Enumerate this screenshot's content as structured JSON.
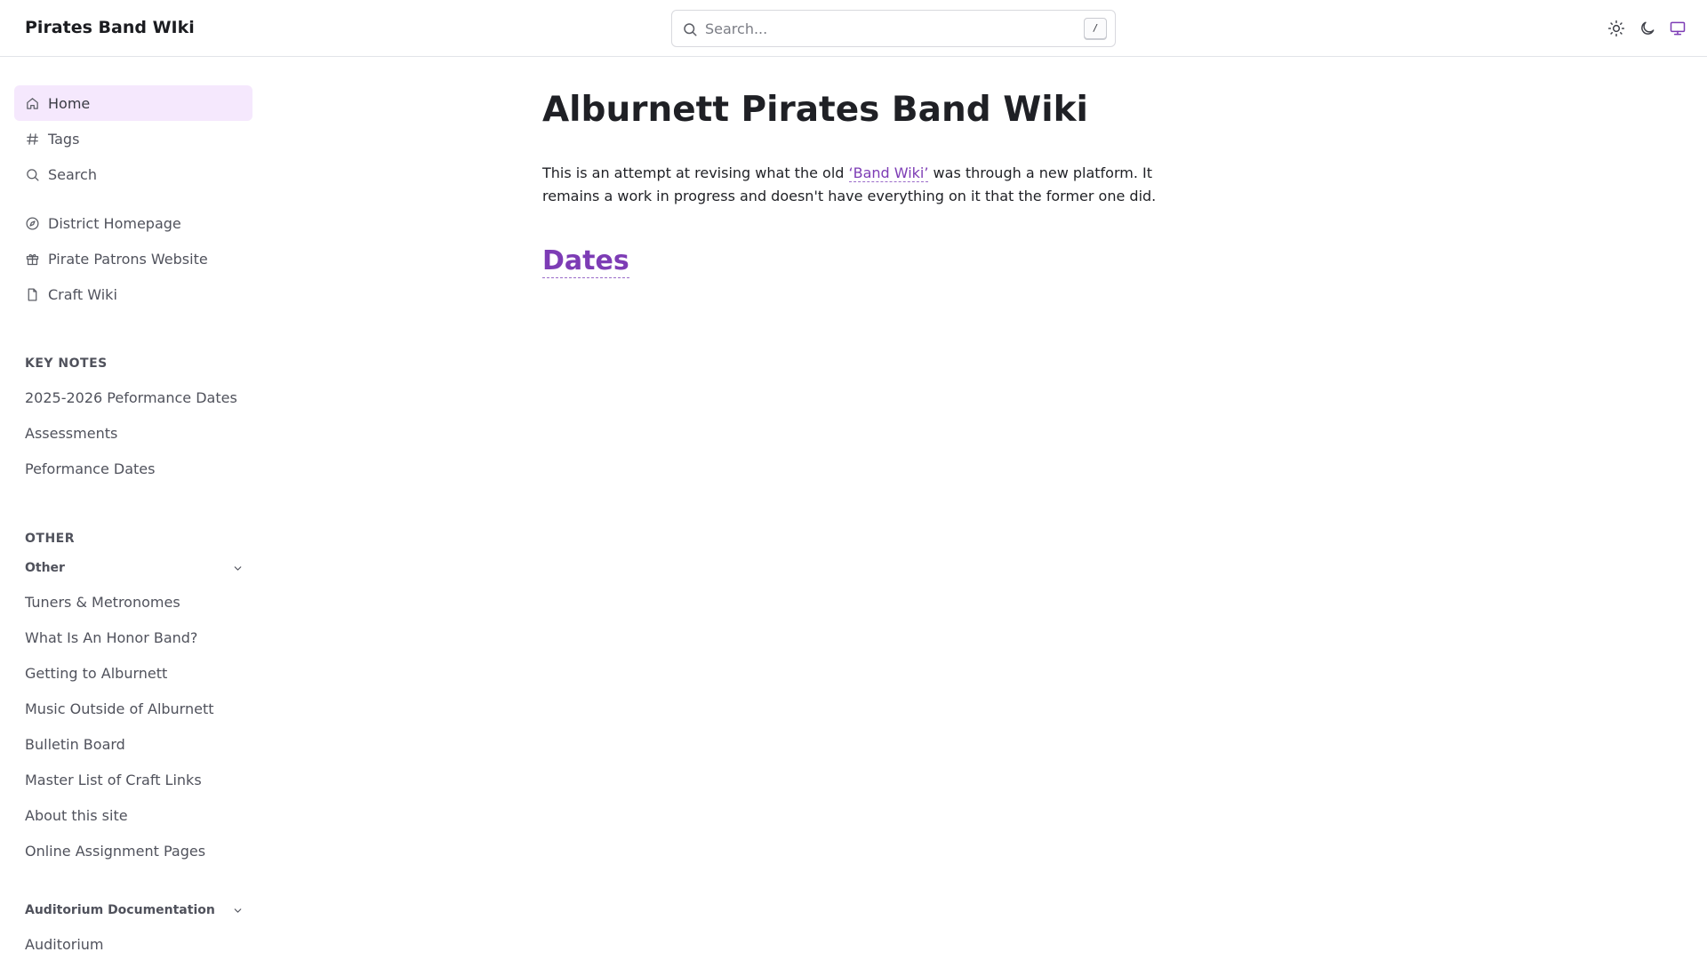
{
  "header": {
    "site_title": "Pirates Band WIki",
    "search_placeholder": "Search...",
    "search_shortcut": "/",
    "theme_buttons": [
      "light-mode",
      "dark-mode",
      "system-mode"
    ]
  },
  "sidebar": {
    "primary": [
      {
        "label": "Home",
        "icon": "home-icon",
        "active": true
      },
      {
        "label": "Tags",
        "icon": "hash-icon"
      },
      {
        "label": "Search",
        "icon": "search-icon"
      }
    ],
    "external": [
      {
        "label": "District Homepage",
        "icon": "compass-icon"
      },
      {
        "label": "Pirate Patrons Website",
        "icon": "gift-icon"
      },
      {
        "label": "Craft Wiki",
        "icon": "file-icon"
      }
    ],
    "key_notes": {
      "heading": "KEY NOTES",
      "items": [
        "2025-2026 Peformance Dates",
        "Assessments",
        "Peformance Dates"
      ]
    },
    "other": {
      "heading": "OTHER",
      "group_label": "Other",
      "items": [
        "Tuners & Metronomes",
        "What Is An Honor Band?",
        "Getting to Alburnett",
        "Music Outside of Alburnett",
        "Bulletin Board",
        "Master List of Craft Links",
        "About this site",
        "Online Assignment Pages"
      ]
    },
    "auditorium": {
      "group_label": "Auditorium Documentation",
      "items": [
        "Auditorium"
      ]
    }
  },
  "main": {
    "title": "Alburnett Pirates Band Wiki",
    "intro_before": "This is an attempt at revising what the old ",
    "intro_link": "‘Band Wiki’",
    "intro_after": " was through a new platform. It remains a work in progress and doesn't have everything on it that the former one did.",
    "section_link": "Dates"
  },
  "colors": {
    "accent": "#7d3cb5",
    "active_bg": "#f5e8fd",
    "text": "#1f2025",
    "muted": "#50525c"
  }
}
